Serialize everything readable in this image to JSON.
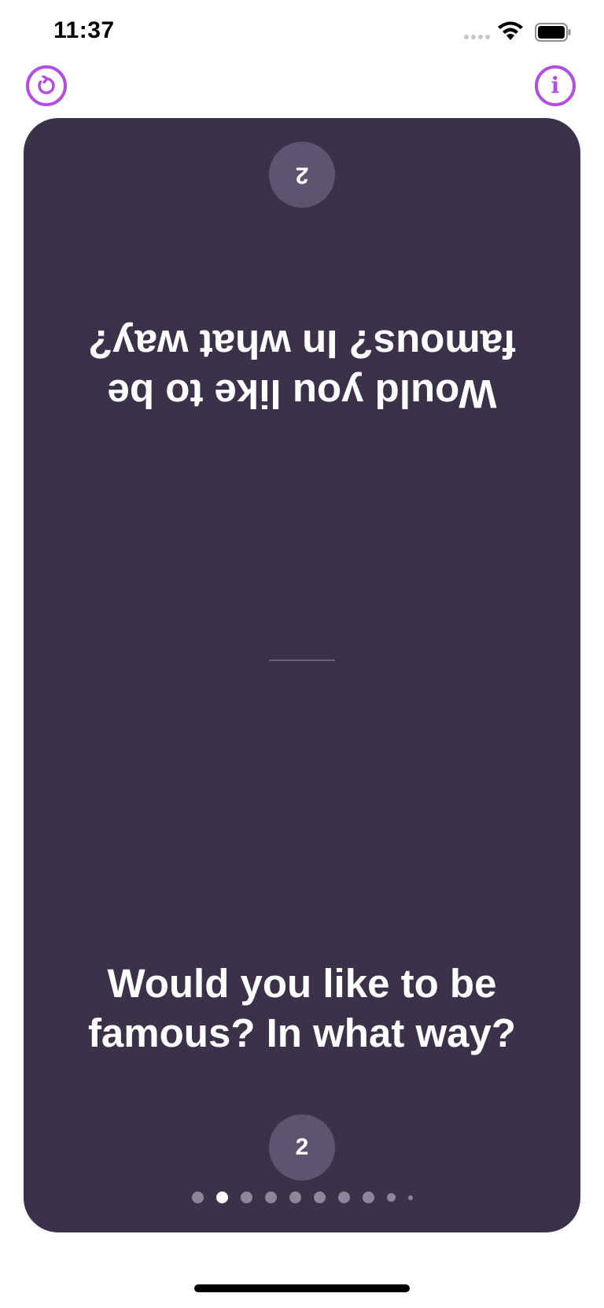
{
  "status_bar": {
    "time": "11:37"
  },
  "top_bar": {
    "refresh_icon": "refresh-icon",
    "info_icon": "info-icon",
    "info_glyph": "i",
    "accent_color": "#b44ee0"
  },
  "card": {
    "background": "#3b3149",
    "number": "2",
    "question": "Would you like to be famous? In what way?"
  },
  "pagination": {
    "total_dots": 10,
    "active_index": 1
  }
}
